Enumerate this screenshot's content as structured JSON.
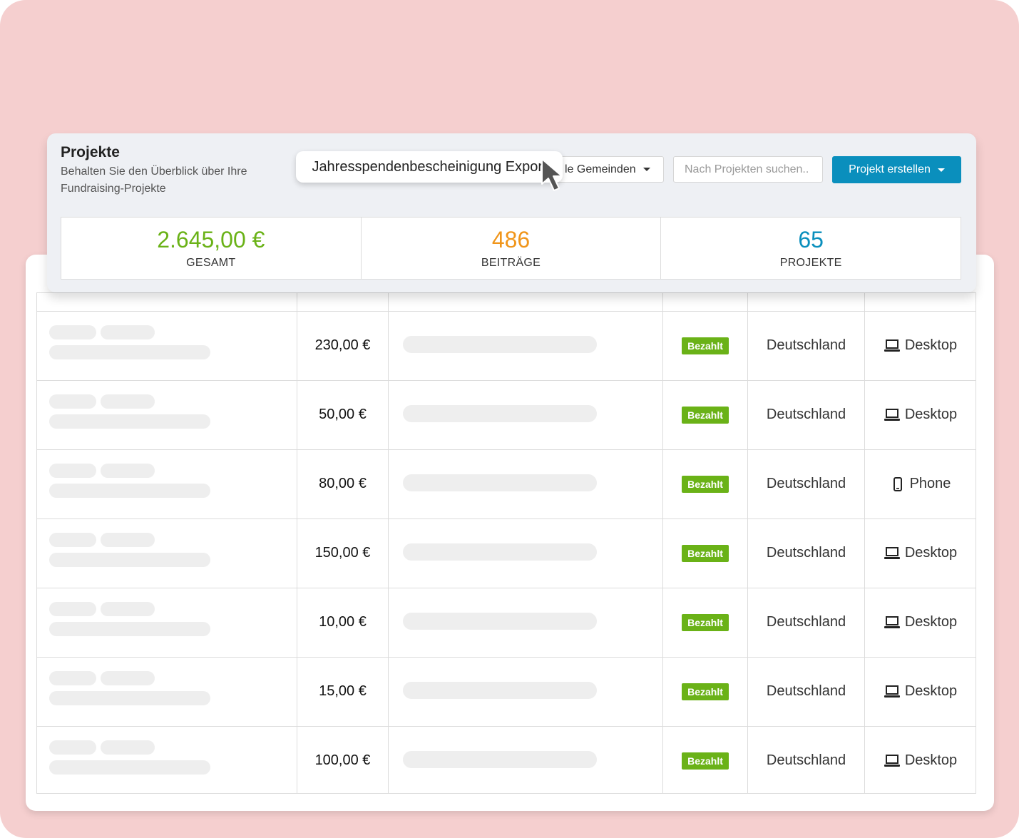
{
  "header": {
    "title": "Projekte",
    "subtitle": "Behalten Sie den Überblick über Ihre Fundraising-Projekte",
    "tooltip": "Jahresspendenbescheinigung Export",
    "gemeinden_label": "le Gemeinden",
    "search_placeholder": "Nach Projekten suchen..",
    "create_label": "Projekt erstellen"
  },
  "stats": [
    {
      "value": "2.645,00 €",
      "label": "GESAMT",
      "color": "#6ab217"
    },
    {
      "value": "486",
      "label": "BEITRÄGE",
      "color": "#f0951a"
    },
    {
      "value": "65",
      "label": "PROJEKTE",
      "color": "#0a8fbd"
    }
  ],
  "rows": [
    {
      "amount": "230,00 €",
      "status": "Bezahlt",
      "country": "Deutschland",
      "device": "Desktop",
      "device_icon": "laptop-icon"
    },
    {
      "amount": "50,00 €",
      "status": "Bezahlt",
      "country": "Deutschland",
      "device": "Desktop",
      "device_icon": "laptop-icon"
    },
    {
      "amount": "80,00 €",
      "status": "Bezahlt",
      "country": "Deutschland",
      "device": "Phone",
      "device_icon": "phone-icon"
    },
    {
      "amount": "150,00 €",
      "status": "Bezahlt",
      "country": "Deutschland",
      "device": "Desktop",
      "device_icon": "laptop-icon"
    },
    {
      "amount": "10,00 €",
      "status": "Bezahlt",
      "country": "Deutschland",
      "device": "Desktop",
      "device_icon": "laptop-icon"
    },
    {
      "amount": "15,00 €",
      "status": "Bezahlt",
      "country": "Deutschland",
      "device": "Desktop",
      "device_icon": "laptop-icon"
    },
    {
      "amount": "100,00 €",
      "status": "Bezahlt",
      "country": "Deutschland",
      "device": "Desktop",
      "device_icon": "laptop-icon"
    }
  ]
}
